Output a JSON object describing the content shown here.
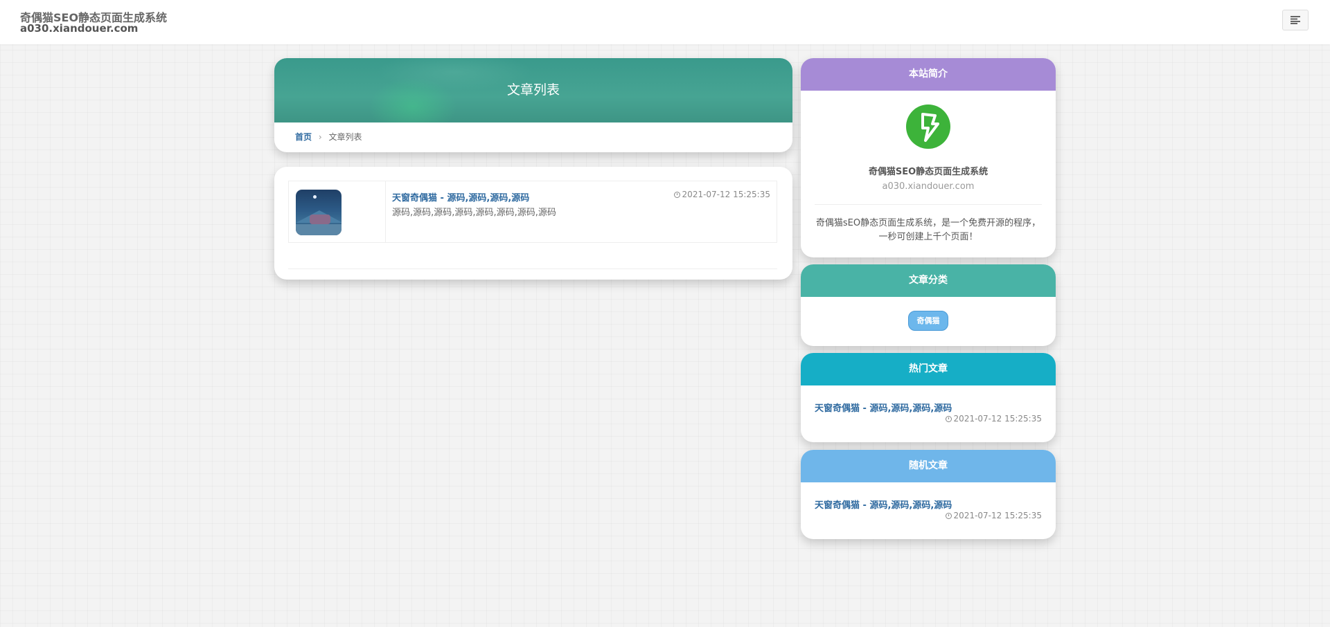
{
  "header": {
    "site_title": "奇偶猫SEO静态页面生成系统",
    "site_domain": "a030.xiandouer.com"
  },
  "main": {
    "banner_title": "文章列表",
    "breadcrumb": {
      "home": "首页",
      "separator": "›",
      "current": "文章列表"
    },
    "articles": [
      {
        "title": "天窗奇偶猫 - 源码,源码,源码,源码",
        "excerpt": "源码,源码,源码,源码,源码,源码,源码,源码",
        "date": "2021-07-12 15:25:35"
      }
    ]
  },
  "sidebar": {
    "about": {
      "heading": "本站简介",
      "name": "奇偶猫SEO静态页面生成系统",
      "domain": "a030.xiandouer.com",
      "description": "奇偶猫sEO静态页面生成系统，是一个免费开源的程序，一秒可创建上千个页面！",
      "color": "#a68bd6"
    },
    "categories": {
      "heading": "文章分类",
      "tags": [
        "奇偶猫"
      ],
      "color": "#49b3a6"
    },
    "hot": {
      "heading": "热门文章",
      "title": "天窗奇偶猫 - 源码,源码,源码,源码",
      "date": "2021-07-12 15:25:35",
      "color": "#16aec6"
    },
    "random": {
      "heading": "随机文章",
      "title": "天窗奇偶猫 - 源码,源码,源码,源码",
      "date": "2021-07-12 15:25:35",
      "color": "#6fb6ea"
    }
  },
  "icons": {
    "menu": "menu-icon",
    "logo": "lightning-logo-icon",
    "clock": "clock-icon"
  }
}
